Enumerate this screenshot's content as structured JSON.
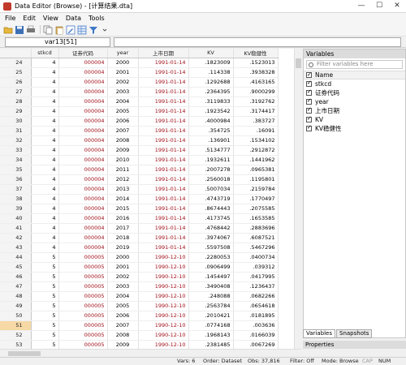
{
  "window": {
    "title": "Data Editor (Browse) - [计算结果.dta]",
    "min": "—",
    "max": "☐",
    "close": "✕"
  },
  "menu": [
    "File",
    "Edit",
    "View",
    "Data",
    "Tools"
  ],
  "cellbar": {
    "name": "var13[51]",
    "value": ""
  },
  "grid": {
    "columns": [
      "stkcd",
      "证券代码",
      "year",
      "上市日期",
      "KV",
      "KV稳健性"
    ],
    "rows": [
      [
        "24",
        "4",
        "000004",
        "2000",
        "1991-01-14",
        ".1823009",
        ".1523013"
      ],
      [
        "25",
        "4",
        "000004",
        "2001",
        "1991-01-14",
        ".114338",
        ".3938328"
      ],
      [
        "26",
        "4",
        "000004",
        "2002",
        "1991-01-14",
        ".1292688",
        ".4163165"
      ],
      [
        "27",
        "4",
        "000004",
        "2003",
        "1991-01-14",
        ".2364395",
        ".9000299"
      ],
      [
        "28",
        "4",
        "000004",
        "2004",
        "1991-01-14",
        ".3119833",
        ".3192762"
      ],
      [
        "29",
        "4",
        "000004",
        "2005",
        "1991-01-14",
        ".1923542",
        ".3174417"
      ],
      [
        "30",
        "4",
        "000004",
        "2006",
        "1991-01-14",
        ".4000984",
        ".383727"
      ],
      [
        "31",
        "4",
        "000004",
        "2007",
        "1991-01-14",
        ".354725",
        ".16091"
      ],
      [
        "32",
        "4",
        "000004",
        "2008",
        "1991-01-14",
        ".136901",
        ".1534102"
      ],
      [
        "33",
        "4",
        "000004",
        "2009",
        "1991-01-14",
        ".5134777",
        ".2912872"
      ],
      [
        "34",
        "4",
        "000004",
        "2010",
        "1991-01-14",
        ".1932611",
        ".1441962"
      ],
      [
        "35",
        "4",
        "000004",
        "2011",
        "1991-01-14",
        ".2007278",
        ".0965381"
      ],
      [
        "36",
        "4",
        "000004",
        "2012",
        "1991-01-14",
        ".2560018",
        ".1195801"
      ],
      [
        "37",
        "4",
        "000004",
        "2013",
        "1991-01-14",
        ".5007034",
        ".2159784"
      ],
      [
        "38",
        "4",
        "000004",
        "2014",
        "1991-01-14",
        ".4743719",
        ".1770497"
      ],
      [
        "39",
        "4",
        "000004",
        "2015",
        "1991-01-14",
        ".8674443",
        ".2075585"
      ],
      [
        "40",
        "4",
        "000004",
        "2016",
        "1991-01-14",
        ".4173745",
        ".1653585"
      ],
      [
        "41",
        "4",
        "000004",
        "2017",
        "1991-01-14",
        ".4768442",
        ".2883696"
      ],
      [
        "42",
        "4",
        "000004",
        "2018",
        "1991-01-14",
        ".3974067",
        ".6087521"
      ],
      [
        "43",
        "4",
        "000004",
        "2019",
        "1991-01-14",
        ".5597508",
        ".5467296"
      ],
      [
        "44",
        "5",
        "000005",
        "2000",
        "1990-12-10",
        ".2280053",
        ".0400734"
      ],
      [
        "45",
        "5",
        "000005",
        "2001",
        "1990-12-10",
        ".0906499",
        ".039312"
      ],
      [
        "46",
        "5",
        "000005",
        "2002",
        "1990-12-10",
        ".1454497",
        ".0417995"
      ],
      [
        "47",
        "5",
        "000005",
        "2003",
        "1990-12-10",
        ".3490408",
        ".1236437"
      ],
      [
        "48",
        "5",
        "000005",
        "2004",
        "1990-12-10",
        ".248088",
        ".0682266"
      ],
      [
        "49",
        "5",
        "000005",
        "2005",
        "1990-12-10",
        ".2563784",
        ".0654618"
      ],
      [
        "50",
        "5",
        "000005",
        "2006",
        "1990-12-10",
        ".2010421",
        ".0181895"
      ],
      [
        "51",
        "5",
        "000005",
        "2007",
        "1990-12-10",
        ".0774168",
        ".003636"
      ],
      [
        "52",
        "5",
        "000005",
        "2008",
        "1990-12-10",
        ".1968143",
        ".0166039"
      ],
      [
        "53",
        "5",
        "000005",
        "2009",
        "1990-12-10",
        ".2381485",
        ".0067269"
      ]
    ],
    "selected_row": "51"
  },
  "variables": {
    "title": "Variables",
    "filter_placeholder": "Filter variables here",
    "header": "Name",
    "items": [
      "stkcd",
      "证券代码",
      "year",
      "上市日期",
      "KV",
      "KV稳健性"
    ]
  },
  "tabs": [
    "Variables",
    "Snapshots"
  ],
  "properties": {
    "title": "Properties"
  },
  "status": {
    "vars": "Vars: 6",
    "order": "Order: Dataset",
    "obs": "Obs: 37,816",
    "filter": "Filter: Off",
    "mode": "Mode: Browse",
    "cap": "CAP",
    "num": "NUM"
  }
}
